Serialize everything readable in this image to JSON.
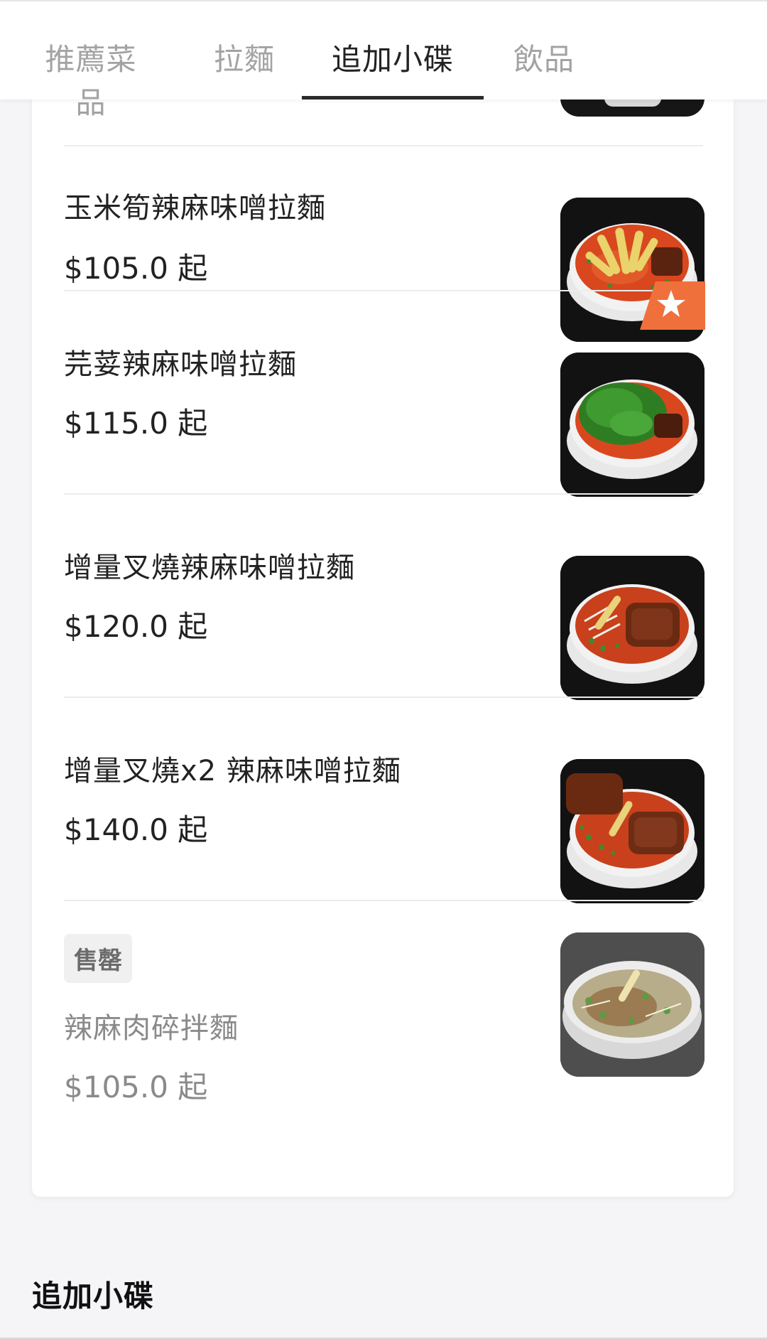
{
  "tabs": [
    {
      "label": "推薦菜品",
      "active": false
    },
    {
      "label": "拉麵",
      "active": false
    },
    {
      "label": "追加小碟",
      "active": true
    },
    {
      "label": "飲品",
      "active": false
    }
  ],
  "items": [
    {
      "name": "玉米筍辣麻味噌拉麵",
      "price": "$105.0 起",
      "image": "ramen-baby-corn"
    },
    {
      "name": "芫荽辣麻味噌拉麵",
      "price": "$115.0 起",
      "image": "ramen-cilantro",
      "featured_icon": "star-icon"
    },
    {
      "name": "增量叉燒辣麻味噌拉麵",
      "price": "$120.0 起",
      "image": "ramen-extra-chashu"
    },
    {
      "name": "增量叉燒x2 辣麻味噌拉麵",
      "price": "$140.0 起",
      "image": "ramen-double-chashu"
    },
    {
      "name": "辣麻肉碎拌麵",
      "price": "$105.0 起",
      "image": "dry-noodles-minced-pork",
      "badge": "售罄",
      "sold_out": true
    }
  ],
  "section_title": "追加小碟",
  "colors": {
    "accent_star": "#f0703c",
    "text": "#222222",
    "muted": "#8a8a8a"
  }
}
